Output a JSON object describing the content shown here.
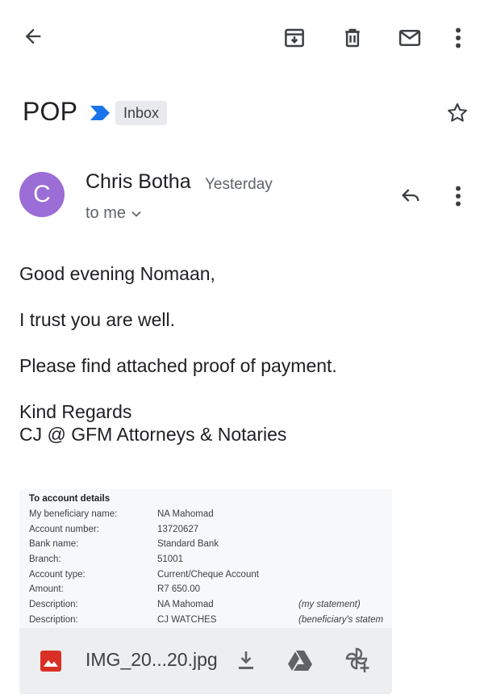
{
  "toolbar": {
    "back_icon": "arrow-back-icon",
    "archive_icon": "archive-icon",
    "delete_icon": "trash-icon",
    "unread_icon": "mail-icon",
    "more_icon": "more-vert-icon"
  },
  "subject": {
    "title": "POP",
    "importance_icon": "important-marker-icon",
    "label": "Inbox",
    "star_icon": "star-outline-icon"
  },
  "message": {
    "avatar_letter": "C",
    "avatar_color": "#9a6dd7",
    "sender": "Chris Botha",
    "time": "Yesterday",
    "recipients": "to me",
    "reply_icon": "reply-icon",
    "more_icon": "more-vert-icon"
  },
  "body": {
    "greeting": "Good evening Nomaan,",
    "line1": "I trust you are well.",
    "line2": "Please find attached proof of payment.",
    "signoff1": "Kind Regards",
    "signoff2": "CJ @ GFM Attorneys & Notaries"
  },
  "attachment": {
    "preview": {
      "heading": "To account details",
      "rows": [
        {
          "label": "My beneficiary name:",
          "value": "NA Mahomad",
          "note": ""
        },
        {
          "label": "Account number:",
          "value": "13720627",
          "note": ""
        },
        {
          "label": "Bank name:",
          "value": "Standard Bank",
          "note": ""
        },
        {
          "label": "Branch:",
          "value": "51001",
          "note": ""
        },
        {
          "label": "Account type:",
          "value": "Current/Cheque Account",
          "note": ""
        },
        {
          "label": "Amount:",
          "value": "R7 650.00",
          "note": ""
        },
        {
          "label": "Description:",
          "value": "NA Mahomad",
          "note": "(my statement)"
        },
        {
          "label": "Description:",
          "value": "CJ WATCHES",
          "note": "(beneficiary's statem"
        }
      ]
    },
    "filename": "IMG_20...20.jpg",
    "file_icon": "image-file-icon",
    "download_icon": "download-icon",
    "drive_icon": "google-drive-icon",
    "photos_icon": "add-to-photos-icon"
  }
}
